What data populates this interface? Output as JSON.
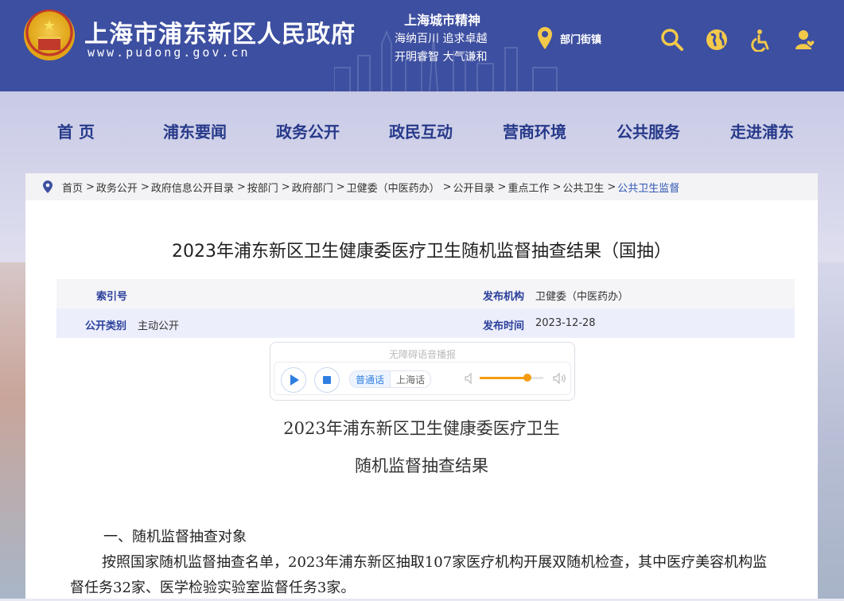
{
  "header": {
    "site_title": "上海市浦东新区人民政府",
    "site_url": "www.pudong.gov.cn",
    "spirit_title": "上海城市精神",
    "spirit_line1": "海纳百川  追求卓越",
    "spirit_line2": "开明睿智  大气谦和",
    "dept_link": "部门街镇",
    "icons": [
      "search-icon",
      "globe-icon",
      "accessibility-icon",
      "user-icon"
    ]
  },
  "nav": [
    "首 页",
    "浦东要闻",
    "政务公开",
    "政民互动",
    "营商环境",
    "公共服务",
    "走进浦东"
  ],
  "breadcrumb": [
    "首页",
    "政务公开",
    "政府信息公开目录",
    "按部门",
    "政府部门",
    "卫健委（中医药办）",
    "公开目录",
    "重点工作",
    "公共卫生",
    "公共卫生监督"
  ],
  "article": {
    "title": "2023年浦东新区卫生健康委医疗卫生随机监督抽查结果（国抽）",
    "meta": {
      "index_label": "索引号",
      "index_value": "",
      "org_label": "发布机构",
      "org_value": "卫健委（中医药办）",
      "category_label": "公开类别",
      "category_value": "主动公开",
      "date_label": "发布时间",
      "date_value": "2023-12-28"
    },
    "player": {
      "hint": "无障碍语音播报",
      "lang_on": "普通话",
      "lang_off": "上海话",
      "volume": 0.75
    },
    "body_title1": "2023年浦东新区卫生健康委医疗卫生",
    "body_title2": "随机监督抽查结果",
    "section1": "一、随机监督抽查对象",
    "para1": "按照国家随机监督抽查名单，2023年浦东新区抽取107家医疗机构开展双随机检查，其中医疗美容机构监督任务32家、医学检验实验室监督任务3家。"
  },
  "colors": {
    "header_bg": "#3d4fa0",
    "nav_text": "#273a8a",
    "accent_yellow": "#f3c94a",
    "link_blue": "#2f56b3"
  }
}
